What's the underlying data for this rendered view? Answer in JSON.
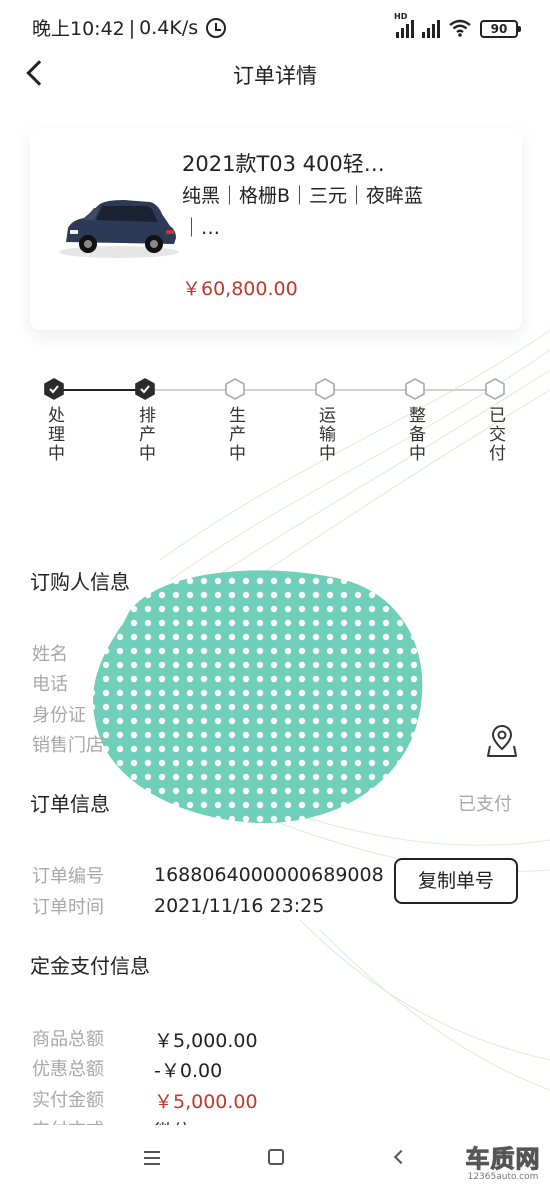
{
  "status_bar": {
    "time": "晚上10:42",
    "speed": "0.4K/s",
    "hd": "HD",
    "battery": "90"
  },
  "nav": {
    "title": "订单详情"
  },
  "product": {
    "title": "2021款T03 400轻…",
    "spec": "纯黑｜格栅B｜三元｜夜眸蓝｜…",
    "price": "￥60,800.00"
  },
  "progress": {
    "current_step_index": 1,
    "steps": [
      {
        "label": "处理中",
        "done": true
      },
      {
        "label": "排产中",
        "done": true
      },
      {
        "label": "生产中",
        "done": false
      },
      {
        "label": "运输中",
        "done": false
      },
      {
        "label": "整备中",
        "done": false
      },
      {
        "label": "已交付",
        "done": false
      }
    ]
  },
  "buyer": {
    "title": "订购人信息",
    "labels": {
      "name": "姓名",
      "phone": "电话",
      "id_card": "身份证",
      "store": "销售门店"
    }
  },
  "order": {
    "title": "订单信息",
    "status": "已支付",
    "number_label": "订单编号",
    "number": "1688064000000689008",
    "time_label": "订单时间",
    "time": "2021/11/16 23:25",
    "copy_button": "复制单号"
  },
  "deposit": {
    "title": "定金支付信息",
    "total_label": "商品总额",
    "total": "￥5,000.00",
    "discount_label": "优惠总额",
    "discount": "-￥0.00",
    "paid_label": "实付金额",
    "paid": "￥5,000.00",
    "method_label": "支付方式",
    "method": "微信"
  },
  "watermark": {
    "big": "车质网",
    "small": "12365auto.com"
  },
  "colors": {
    "accent_red": "#c0392b",
    "muted": "#a8a8a8",
    "blob": "#6fcfb8"
  }
}
